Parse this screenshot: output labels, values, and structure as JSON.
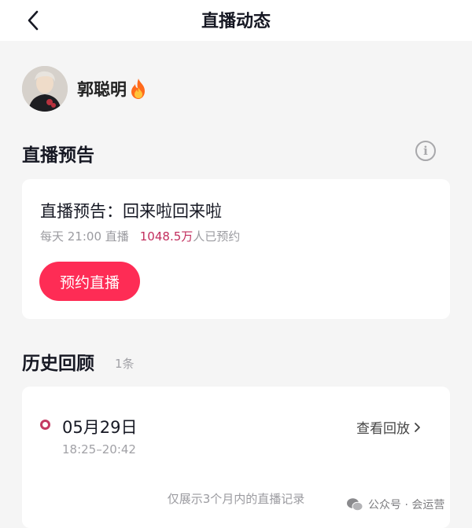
{
  "header": {
    "title": "直播动态"
  },
  "user": {
    "name": "郭聪明"
  },
  "preview": {
    "section_title": "直播预告",
    "card_title": "直播预告：回来啦回来啦",
    "schedule": "每天 21:00 直播",
    "reserve_count": "1048.5万",
    "reserve_suffix": "人已预约",
    "reserve_button": "预约直播"
  },
  "history": {
    "section_title": "历史回顾",
    "count": "1条",
    "records": [
      {
        "date": "05月29日",
        "time": "18:25–20:42",
        "replay_label": "查看回放"
      }
    ],
    "note": "仅展示3个月内的直播记录"
  },
  "watermark": {
    "text": "公众号 · 会运营"
  },
  "icons": {
    "back": "chevron-left-icon",
    "info": "info-icon",
    "fire": "fire-icon",
    "chevron": "chevron-right-icon",
    "wechat": "wechat-icon"
  },
  "colors": {
    "accent": "#fe2c55",
    "highlight": "#c22e5e",
    "record_dot": "#c43a63",
    "background": "#f5f5f5"
  }
}
